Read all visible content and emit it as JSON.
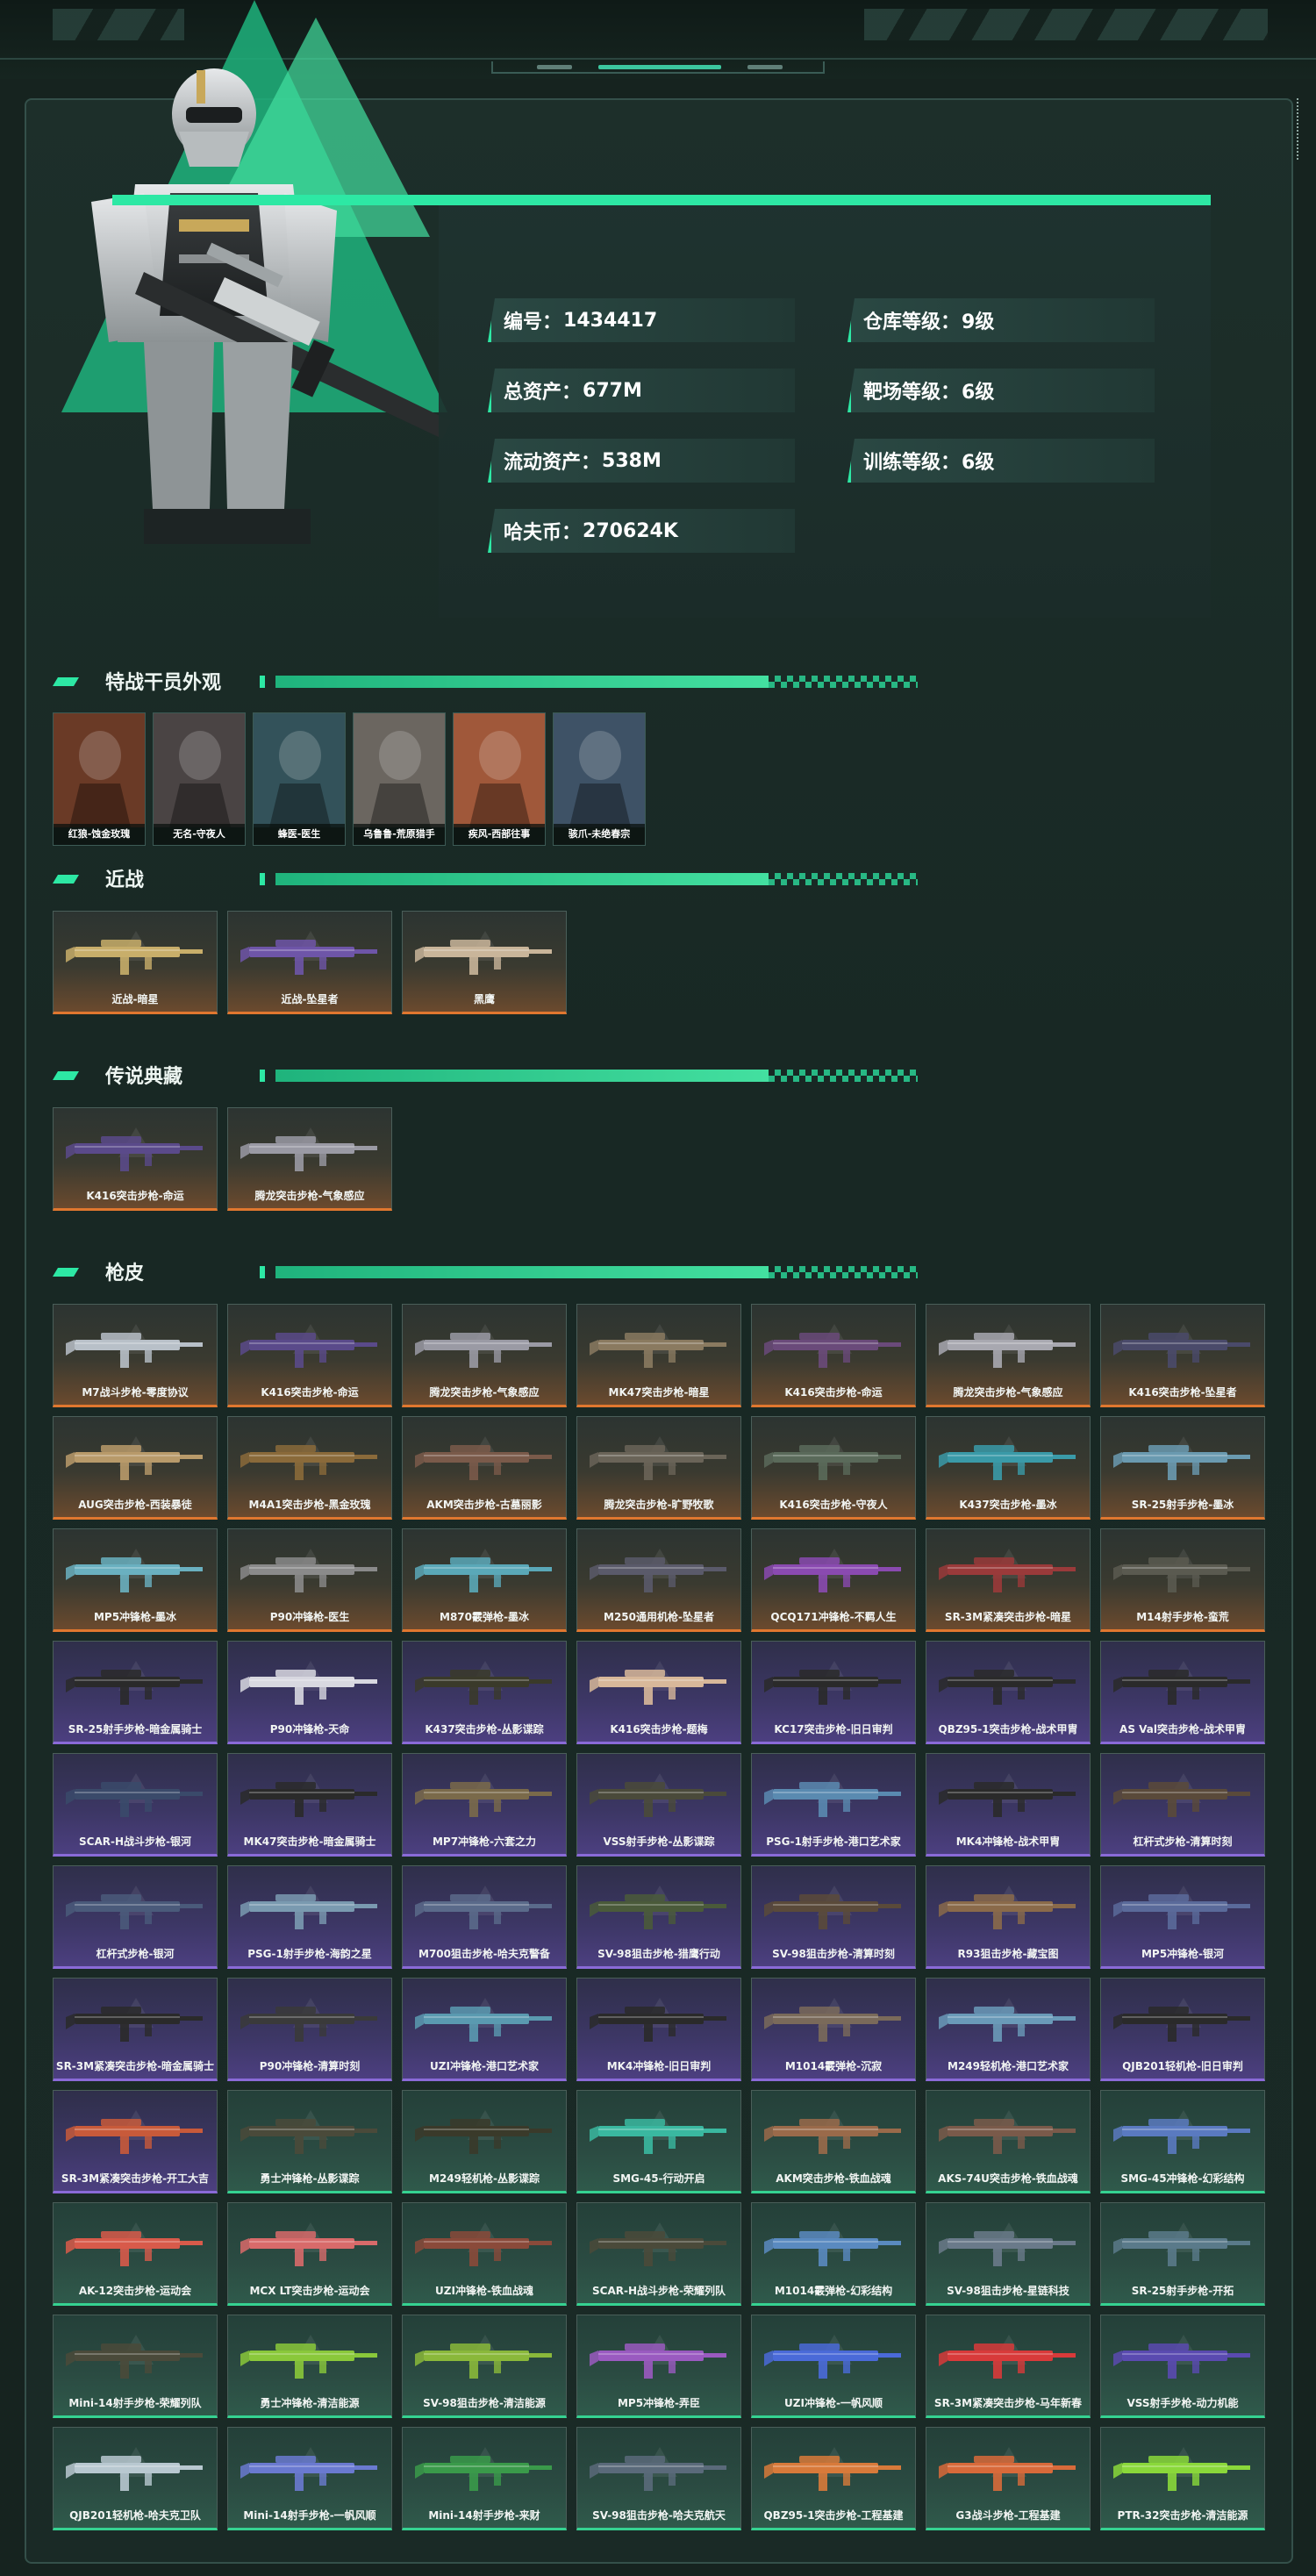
{
  "profile": {
    "stats": [
      {
        "label": "编号：",
        "value": "1434417"
      },
      {
        "label": "仓库等级：",
        "value": "9级"
      },
      {
        "label": "总资产：",
        "value": "677M"
      },
      {
        "label": "靶场等级：",
        "value": "6级"
      },
      {
        "label": "流动资产：",
        "value": "538M"
      },
      {
        "label": "训练等级：",
        "value": "6级"
      },
      {
        "label": "哈夫币：",
        "value": "270624K"
      }
    ]
  },
  "sections": {
    "operators": "特战干员外观",
    "melee": "近战",
    "legend": "传说典藏",
    "skins": "枪皮"
  },
  "operators": [
    {
      "name": "红狼-蚀金玫瑰",
      "color": "#6a3a26"
    },
    {
      "name": "无名-守夜人",
      "color": "#4a4444"
    },
    {
      "name": "蜂医-医生",
      "color": "#33525a"
    },
    {
      "name": "乌鲁鲁-荒原猎手",
      "color": "#6b6660"
    },
    {
      "name": "疾风-西部往事",
      "color": "#a0583a"
    },
    {
      "name": "骇爪-未绝春宗",
      "color": "#3e5266"
    }
  ],
  "melee": [
    {
      "name": "近战-暗星",
      "tier": "orange",
      "gun_color": "#c8ae6a"
    },
    {
      "name": "近战-坠星者",
      "tier": "orange",
      "gun_color": "#6e55a8"
    },
    {
      "name": "黑鹰",
      "tier": "orange",
      "gun_color": "#c9b59a"
    }
  ],
  "legend": [
    {
      "name": "K416突击步枪-命运",
      "tier": "orange",
      "gun_color": "#5a4a8a"
    },
    {
      "name": "腾龙突击步枪-气象感应",
      "tier": "orange",
      "gun_color": "#9a9aa4"
    }
  ],
  "skins": [
    {
      "name": "M7战斗步枪-零度协议",
      "tier": "orange",
      "gun_color": "#b8c0c8"
    },
    {
      "name": "K416突击步枪-命运",
      "tier": "orange",
      "gun_color": "#5a4a8a"
    },
    {
      "name": "腾龙突击步枪-气象感应",
      "tier": "orange",
      "gun_color": "#9a9aa4"
    },
    {
      "name": "MK47突击步枪-暗星",
      "tier": "orange",
      "gun_color": "#8a7a60"
    },
    {
      "name": "K416突击步枪-命运",
      "tier": "orange",
      "gun_color": "#6a4a7a"
    },
    {
      "name": "腾龙突击步枪-气象感应",
      "tier": "orange",
      "gun_color": "#a8a8b0"
    },
    {
      "name": "K416突击步枪-坠星者",
      "tier": "orange",
      "gun_color": "#4a4a6a"
    },
    {
      "name": "AUG突击步枪-西装暴徒",
      "tier": "orange",
      "gun_color": "#b89a6a"
    },
    {
      "name": "M4A1突击步枪-黑金玫瑰",
      "tier": "orange",
      "gun_color": "#8a6a3a"
    },
    {
      "name": "AKM突击步枪-古墓丽影",
      "tier": "orange",
      "gun_color": "#7a5a4a"
    },
    {
      "name": "腾龙突击步枪-旷野牧歌",
      "tier": "orange",
      "gun_color": "#6a6458"
    },
    {
      "name": "K416突击步枪-守夜人",
      "tier": "orange",
      "gun_color": "#5a6a5a"
    },
    {
      "name": "K437突击步枪-墨冰",
      "tier": "orange",
      "gun_color": "#3a9aa8"
    },
    {
      "name": "SR-25射手步枪-墨冰",
      "tier": "orange",
      "gun_color": "#6a9ab0"
    },
    {
      "name": "MP5冲锋枪-墨冰",
      "tier": "orange",
      "gun_color": "#6ab0c0"
    },
    {
      "name": "P90冲锋枪-医生",
      "tier": "orange",
      "gun_color": "#8a8a8a"
    },
    {
      "name": "M870霰弹枪-墨冰",
      "tier": "orange",
      "gun_color": "#5aa8b8"
    },
    {
      "name": "M250通用机枪-坠星者",
      "tier": "orange",
      "gun_color": "#5a5a6a"
    },
    {
      "name": "QCQ171冲锋枪-不羁人生",
      "tier": "orange",
      "gun_color": "#8a4ab0"
    },
    {
      "name": "SR-3M紧凑突击步枪-暗星",
      "tier": "orange",
      "gun_color": "#9a3a3a"
    },
    {
      "name": "M14射手步枪-蛮荒",
      "tier": "orange",
      "gun_color": "#5a5a50"
    },
    {
      "name": "SR-25射手步枪-暗金属骑士",
      "tier": "purple",
      "gun_color": "#2a2a2a"
    },
    {
      "name": "P90冲锋枪-天命",
      "tier": "purple",
      "gun_color": "#d8d8e0"
    },
    {
      "name": "K437突击步枪-丛影谍踪",
      "tier": "purple",
      "gun_color": "#3a3a2a"
    },
    {
      "name": "K416突击步枪-题梅",
      "tier": "purple",
      "gun_color": "#d8b89a"
    },
    {
      "name": "KC17突击步枪-旧日审判",
      "tier": "purple",
      "gun_color": "#2a2a2a"
    },
    {
      "name": "QBZ95-1突击步枪-战术甲胄",
      "tier": "purple",
      "gun_color": "#2a2a2a"
    },
    {
      "name": "AS Val突击步枪-战术甲胄",
      "tier": "purple",
      "gun_color": "#2a2a2a"
    },
    {
      "name": "SCAR-H战斗步枪-银河",
      "tier": "purple",
      "gun_color": "#3a4a6a"
    },
    {
      "name": "MK47突击步枪-暗金属骑士",
      "tier": "purple",
      "gun_color": "#2a2a2a"
    },
    {
      "name": "MP7冲锋枪-六套之力",
      "tier": "purple",
      "gun_color": "#7a6a4a"
    },
    {
      "name": "VSS射手步枪-丛影谍踪",
      "tier": "purple",
      "gun_color": "#4a4a3a"
    },
    {
      "name": "PSG-1射手步枪-港口艺术家",
      "tier": "purple",
      "gun_color": "#5a8ab0"
    },
    {
      "name": "MK4冲锋枪-战术甲胄",
      "tier": "purple",
      "gun_color": "#2a2a2a"
    },
    {
      "name": "杠杆式步枪-清算时刻",
      "tier": "purple",
      "gun_color": "#5a4a3a"
    },
    {
      "name": "杠杆式步枪-银河",
      "tier": "purple",
      "gun_color": "#4a5a7a"
    },
    {
      "name": "PSG-1射手步枪-海韵之星",
      "tier": "purple",
      "gun_color": "#7a9ab0"
    },
    {
      "name": "M700狙击步枪-哈夫克警备",
      "tier": "purple",
      "gun_color": "#5a6a8a"
    },
    {
      "name": "SV-98狙击步枪-猎鹰行动",
      "tier": "purple",
      "gun_color": "#4a5a3a"
    },
    {
      "name": "SV-98狙击步枪-清算时刻",
      "tier": "purple",
      "gun_color": "#5a4a3a"
    },
    {
      "name": "R93狙击步枪-藏宝图",
      "tier": "purple",
      "gun_color": "#8a6a4a"
    },
    {
      "name": "MP5冲锋枪-银河",
      "tier": "purple",
      "gun_color": "#5a6a9a"
    },
    {
      "name": "SR-3M紧凑突击步枪-暗金属骑士",
      "tier": "purple",
      "gun_color": "#2a2a2a"
    },
    {
      "name": "P90冲锋枪-清算时刻",
      "tier": "purple",
      "gun_color": "#3a3a3a"
    },
    {
      "name": "UZI冲锋枪-港口艺术家",
      "tier": "purple",
      "gun_color": "#5a9ab0"
    },
    {
      "name": "MK4冲锋枪-旧日审判",
      "tier": "purple",
      "gun_color": "#2a2a2a"
    },
    {
      "name": "M1014霰弹枪-沉寂",
      "tier": "purple",
      "gun_color": "#7a6a5a"
    },
    {
      "name": "M249轻机枪-港口艺术家",
      "tier": "purple",
      "gun_color": "#6a9ab8"
    },
    {
      "name": "QJB201轻机枪-旧日审判",
      "tier": "purple",
      "gun_color": "#2a2a2a"
    },
    {
      "name": "SR-3M紧凑突击步枪-开工大吉",
      "tier": "purple",
      "gun_color": "#c85a3a"
    },
    {
      "name": "勇士冲锋枪-丛影谍踪",
      "tier": "green",
      "gun_color": "#4a4a3a"
    },
    {
      "name": "M249轻机枪-丛影谍踪",
      "tier": "green",
      "gun_color": "#3a3a2a"
    },
    {
      "name": "SMG-45-行动开启",
      "tier": "green",
      "gun_color": "#3ab8a0"
    },
    {
      "name": "AKM突击步枪-铁血战魂",
      "tier": "green",
      "gun_color": "#9a6a4a"
    },
    {
      "name": "AKS-74U突击步枪-铁血战魂",
      "tier": "green",
      "gun_color": "#7a5a4a"
    },
    {
      "name": "SMG-45冲锋枪-幻彩结构",
      "tier": "green",
      "gun_color": "#5a7ac0"
    },
    {
      "name": "AK-12突击步枪-运动会",
      "tier": "green",
      "gun_color": "#d85a4a"
    },
    {
      "name": "MCX LT突击步枪-运动会",
      "tier": "green",
      "gun_color": "#d86a6a"
    },
    {
      "name": "UZI冲锋枪-铁血战魂",
      "tier": "green",
      "gun_color": "#8a4a3a"
    },
    {
      "name": "SCAR-H战斗步枪-荣耀列队",
      "tier": "green",
      "gun_color": "#4a4a3a"
    },
    {
      "name": "M1014霰弹枪-幻彩结构",
      "tier": "green",
      "gun_color": "#5a8ac0"
    },
    {
      "name": "SV-98狙击步枪-星链科技",
      "tier": "green",
      "gun_color": "#6a7a8a"
    },
    {
      "name": "SR-25射手步枪-开拓",
      "tier": "green",
      "gun_color": "#5a7a8a"
    },
    {
      "name": "Mini-14射手步枪-荣耀列队",
      "tier": "green",
      "gun_color": "#4a4a3a"
    },
    {
      "name": "勇士冲锋枪-清洁能源",
      "tier": "green",
      "gun_color": "#8ac83a"
    },
    {
      "name": "SV-98狙击步枪-清洁能源",
      "tier": "green",
      "gun_color": "#8ab83a"
    },
    {
      "name": "MP5冲锋枪-弄臣",
      "tier": "green",
      "gun_color": "#9a5ac0"
    },
    {
      "name": "UZI冲锋枪-一帆风顺",
      "tier": "green",
      "gun_color": "#4a6ad8"
    },
    {
      "name": "SR-3M紧凑突击步枪-马年新春",
      "tier": "green",
      "gun_color": "#d83a3a"
    },
    {
      "name": "VSS射手步枪-动力机能",
      "tier": "green",
      "gun_color": "#5a4ab0"
    },
    {
      "name": "QJB201轻机枪-哈夫克卫队",
      "tier": "green",
      "gun_color": "#b8c8d0"
    },
    {
      "name": "Mini-14射手步枪-一帆风顺",
      "tier": "green",
      "gun_color": "#6a7ad0"
    },
    {
      "name": "Mini-14射手步枪-来财",
      "tier": "green",
      "gun_color": "#3a9a4a"
    },
    {
      "name": "SV-98狙击步枪-哈夫克航天",
      "tier": "green",
      "gun_color": "#5a6a7a"
    },
    {
      "name": "QBZ95-1突击步枪-工程基建",
      "tier": "green",
      "gun_color": "#d87a3a"
    },
    {
      "name": "G3战斗步枪-工程基建",
      "tier": "green",
      "gun_color": "#d86a3a"
    },
    {
      "name": "PTR-32突击步枪-清洁能源",
      "tier": "green",
      "gun_color": "#8ad83a"
    }
  ]
}
